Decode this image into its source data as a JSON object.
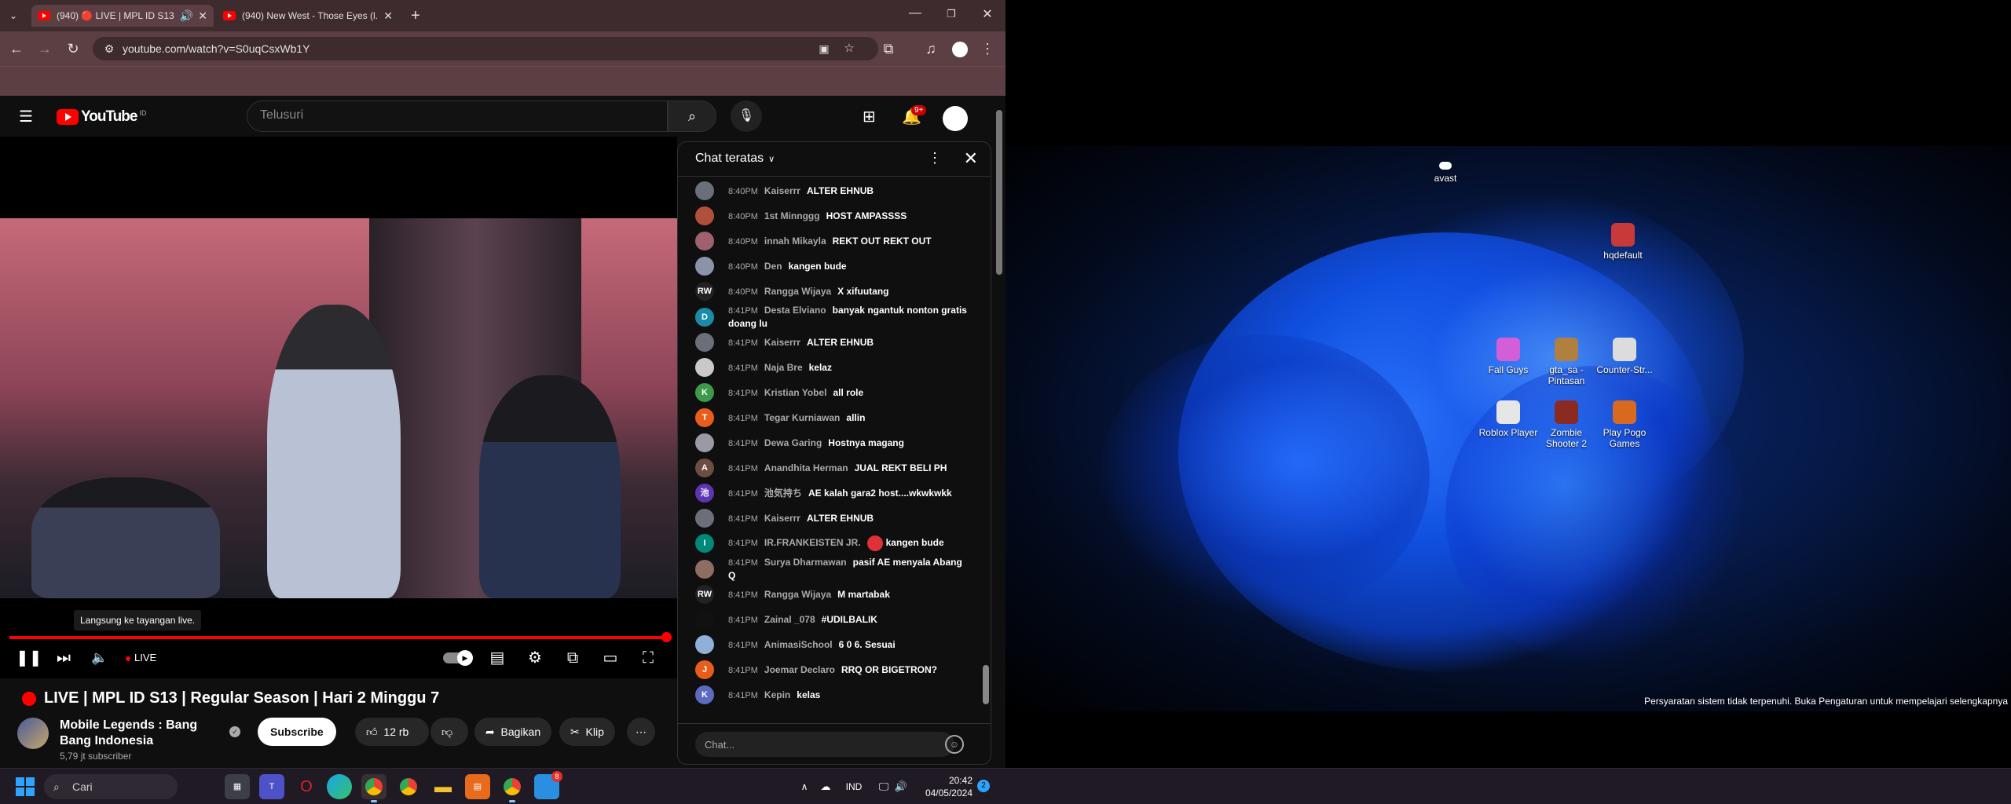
{
  "browser": {
    "tabs": [
      {
        "label": "(940) 🔴 LIVE | MPL ID S13"
      },
      {
        "label": "(940) New West - Those Eyes (l..."
      }
    ],
    "url": "youtube.com/watch?v=S0uqCsxWb1Y"
  },
  "youtube": {
    "logo": "YouTube",
    "logo_country": "ID",
    "search_placeholder": "Telusuri",
    "notification_count": "9+"
  },
  "player": {
    "tooltip": "Langsung ke tayangan live.",
    "live_label": "LIVE",
    "progress": 1.0
  },
  "video": {
    "title": "LIVE | MPL ID S13 | Regular Season | Hari 2 Minggu 7",
    "channel_name": "Mobile Legends : Bang Bang Indonesia",
    "subscribers": "5,79 jt subscriber",
    "subscribe_label": "Subscribe",
    "likes": "12 rb",
    "share_label": "Bagikan",
    "clip_label": "Klip"
  },
  "chat": {
    "title": "Chat teratas",
    "input_placeholder": "Chat...",
    "messages": [
      {
        "time": "8:40PM",
        "author": "Kaiserrr",
        "text": "ALTER EHNUB",
        "initial": "",
        "color": "#6b6f7a"
      },
      {
        "time": "8:40PM",
        "author": "1st Minnggg",
        "text": "HOST AMPASSSS",
        "initial": "",
        "color": "#b0503a"
      },
      {
        "time": "8:40PM",
        "author": "innah Mikayla",
        "text": "REKT OUT REKT OUT",
        "initial": "",
        "color": "#a06070"
      },
      {
        "time": "8:40PM",
        "author": "Den",
        "text": "kangen bude",
        "initial": "",
        "color": "#8a93a8"
      },
      {
        "time": "8:40PM",
        "author": "Rangga Wijaya",
        "text": "X xifuutang",
        "initial": "RW",
        "color": "#222222"
      },
      {
        "time": "8:41PM",
        "author": "Desta Elviano",
        "text": "banyak ngantuk nonton gratis doang lu",
        "initial": "D",
        "color": "#1c8ba8"
      },
      {
        "time": "8:41PM",
        "author": "Kaiserrr",
        "text": "ALTER EHNUB",
        "initial": "",
        "color": "#6b6f7a"
      },
      {
        "time": "8:41PM",
        "author": "Naja Bre",
        "text": "kelaz",
        "initial": "",
        "color": "#c9c9c9"
      },
      {
        "time": "8:41PM",
        "author": "Kristian Yobel",
        "text": "all role",
        "initial": "K",
        "color": "#3c9a4a"
      },
      {
        "time": "8:41PM",
        "author": "Tegar Kurniawan",
        "text": "allin",
        "initial": "T",
        "color": "#e85d1c"
      },
      {
        "time": "8:41PM",
        "author": "Dewa Garing",
        "text": "Hostnya magang",
        "initial": "",
        "color": "#9a9aa4"
      },
      {
        "time": "8:41PM",
        "author": "Anandhita Herman",
        "text": "JUAL REKT BELI PH",
        "initial": "A",
        "color": "#6d4c41"
      },
      {
        "time": "8:41PM",
        "author": "池気持ち",
        "text": "AE kalah gara2 host....wkwkwkk",
        "initial": "池",
        "color": "#5e35b1"
      },
      {
        "time": "8:41PM",
        "author": "Kaiserrr",
        "text": "ALTER EHNUB",
        "initial": "",
        "color": "#6b6f7a"
      },
      {
        "time": "8:41PM",
        "author": "IR.FRANKEISTEN JR.",
        "text": "kangen bude",
        "initial": "I",
        "color": "#00897b",
        "emoji": true
      },
      {
        "time": "8:41PM",
        "author": "Surya Dharmawan",
        "text": "pasif AE menyala Abang Q",
        "initial": "",
        "color": "#8d6e63"
      },
      {
        "time": "8:41PM",
        "author": "Rangga Wijaya",
        "text": "M martabak",
        "initial": "RW",
        "color": "#222222"
      },
      {
        "time": "8:41PM",
        "author": "Zainal _078",
        "text": "#UDILBALIK",
        "initial": "",
        "color": "#111111"
      },
      {
        "time": "8:41PM",
        "author": "AnimasiSchool",
        "text": "6 0 6. Sesuai",
        "initial": "",
        "color": "#8fb0d8"
      },
      {
        "time": "8:41PM",
        "author": "Joemar Declaro",
        "text": "RRQ OR BIGETRON?",
        "initial": "J",
        "color": "#e85d1c"
      },
      {
        "time": "8:41PM",
        "author": "Kepin",
        "text": "kelas",
        "initial": "K",
        "color": "#5c6bc0"
      }
    ]
  },
  "desktop": {
    "icons": [
      {
        "label": "avast",
        "color": "#ffffff"
      },
      {
        "label": "hqdefault",
        "color": "#c83a3a"
      },
      {
        "label": "Fall Guys",
        "color": "#d25fd8"
      },
      {
        "label": "gta_sa - Pintasan",
        "color": "#b08040"
      },
      {
        "label": "Counter-Str...",
        "color": "#dcdcdc"
      },
      {
        "label": "Roblox Player",
        "color": "#e6e6e6"
      },
      {
        "label": "Zombie Shooter 2",
        "color": "#8a2a20"
      },
      {
        "label": "Play Pogo Games",
        "color": "#d86a20"
      }
    ],
    "activation_note": "Persyaratan sistem tidak terpenuhi. Buka Pengaturan untuk mempelajari selengkapnya"
  },
  "taskbar": {
    "search_label": "Cari",
    "lang": "IND",
    "time": "20:42",
    "date": "04/05/2024",
    "notification_count": "2",
    "app_badge": "8"
  }
}
